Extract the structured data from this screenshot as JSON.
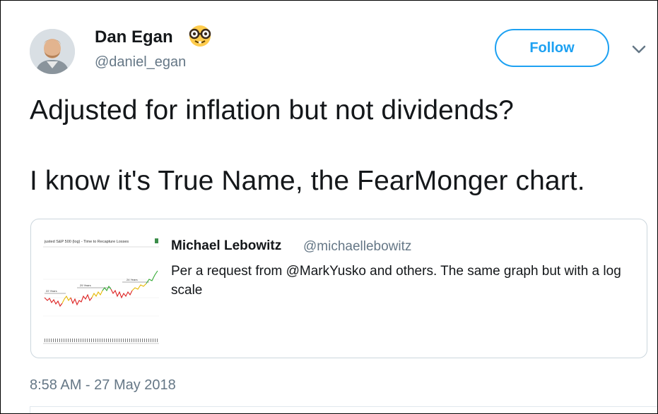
{
  "author": {
    "name": "Dan Egan",
    "handle": "@daniel_egan",
    "emoji": "nerd-face-icon"
  },
  "follow_button": {
    "label": "Follow"
  },
  "more_menu": {
    "icon": "chevron-down-icon"
  },
  "tweet": {
    "line1": "Adjusted for inflation but not dividends?",
    "line2": "I know it's True Name, the FearMonger chart."
  },
  "quoted_tweet": {
    "author_name": "Michael Lebowitz",
    "author_handle": "@michaellebowitz",
    "text": "Per a request from @MarkYusko and others. The same graph but with a log scale",
    "thumbnail": {
      "title": "justed S&P 500 (log) - Time to Recapture Losses",
      "annotations": [
        "22 Years",
        "29 Years",
        "24 Years"
      ]
    }
  },
  "timestamp": "8:58 AM - 27 May 2018",
  "colors": {
    "accent": "#1da1f2",
    "text_primary": "#14171a",
    "text_secondary": "#657786",
    "border": "#ccd6dd"
  }
}
